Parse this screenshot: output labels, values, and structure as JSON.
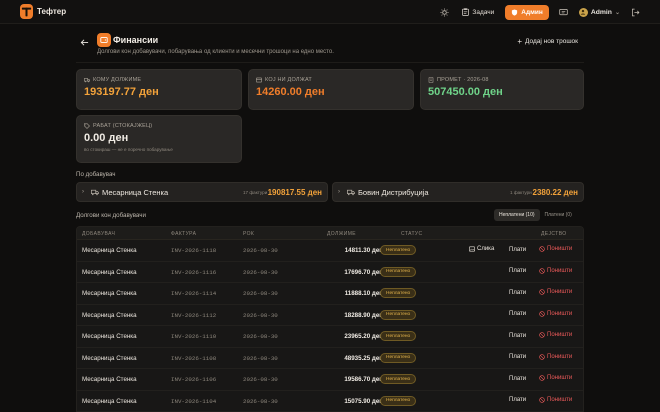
{
  "app": {
    "name": "Тефтер"
  },
  "topbar": {
    "tasks_label": "Задачи",
    "admin_label": "Админ",
    "user_name": "Admin"
  },
  "header": {
    "title": "Финансии",
    "subtitle": "Долгови кон добавувачи, побарувања од клиенти и месечни трошоци на едно место.",
    "add_button": "Додај нов трошок"
  },
  "cards": {
    "owe": {
      "label": "КОМУ ДОЛЖИМЕ",
      "value": "193197.77 ден",
      "color": "#f2a23a"
    },
    "owed": {
      "label": "КОЈ НИ ДОЛЖАТ",
      "value": "14260.00 ден",
      "color": "#f07d2a"
    },
    "turnover": {
      "label": "ПРОМЕТ · 2026-08",
      "value": "507450.00 ден",
      "color": "#6fd389"
    },
    "discount": {
      "label": "РАБАТ (СТОКАЈЖЕЦ)",
      "value": "0.00 ден",
      "note": "во стокираш — не е поречно побарување",
      "color": "#f0ebe4"
    }
  },
  "by_supplier": {
    "label": "По добавувач",
    "items": [
      {
        "name": "Месарница Стенка",
        "count": "17 фактури",
        "amount": "190817.55 ден"
      },
      {
        "name": "Бовин Дистрибуција",
        "count": "1 фактури",
        "amount": "2380.22 ден"
      }
    ]
  },
  "debts": {
    "label": "Долгови кон добавувачи",
    "tabs": [
      {
        "label": "Неплатени (10)"
      },
      {
        "label": "Платени (0)"
      }
    ],
    "columns": {
      "supplier": "ДОБАВУВАЧ",
      "invoice": "ФАКТУРА",
      "due": "РОК",
      "amount": "ДОЛЖИМЕ",
      "status": "СТАТУС",
      "action": "ДЕЈСТВО"
    },
    "status_label": "Неплатено",
    "photo_label": "Слика",
    "pay_label": "Плати",
    "cancel_label": "Поништи",
    "rows": [
      {
        "supplier": "Месарница Стенка",
        "invoice": "INV-2026-1118",
        "due": "2026-08-30",
        "amount": "14811.30 ден",
        "has_photo": true
      },
      {
        "supplier": "Месарница Стенка",
        "invoice": "INV-2026-1116",
        "due": "2026-08-30",
        "amount": "17696.70 ден",
        "has_photo": false
      },
      {
        "supplier": "Месарница Стенка",
        "invoice": "INV-2026-1114",
        "due": "2026-08-30",
        "amount": "11888.10 ден",
        "has_photo": false
      },
      {
        "supplier": "Месарница Стенка",
        "invoice": "INV-2026-1112",
        "due": "2026-08-30",
        "amount": "18288.90 ден",
        "has_photo": false
      },
      {
        "supplier": "Месарница Стенка",
        "invoice": "INV-2026-1110",
        "due": "2026-08-30",
        "amount": "23965.20 ден",
        "has_photo": false
      },
      {
        "supplier": "Месарница Стенка",
        "invoice": "INV-2026-1108",
        "due": "2026-08-30",
        "amount": "48935.25 ден",
        "has_photo": false
      },
      {
        "supplier": "Месарница Стенка",
        "invoice": "INV-2026-1106",
        "due": "2026-08-30",
        "amount": "19586.70 ден",
        "has_photo": false
      },
      {
        "supplier": "Месарница Стенка",
        "invoice": "INV-2026-1104",
        "due": "2026-08-30",
        "amount": "15075.90 ден",
        "has_photo": false
      }
    ]
  }
}
